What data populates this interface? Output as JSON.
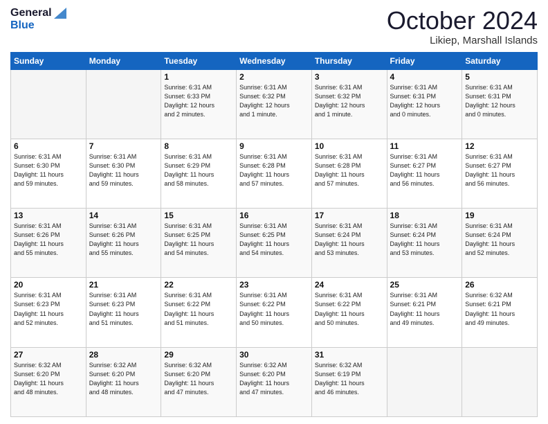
{
  "logo": {
    "line1": "General",
    "line2": "Blue"
  },
  "title": "October 2024",
  "location": "Likiep, Marshall Islands",
  "days_of_week": [
    "Sunday",
    "Monday",
    "Tuesday",
    "Wednesday",
    "Thursday",
    "Friday",
    "Saturday"
  ],
  "weeks": [
    [
      {
        "day": "",
        "detail": ""
      },
      {
        "day": "",
        "detail": ""
      },
      {
        "day": "1",
        "detail": "Sunrise: 6:31 AM\nSunset: 6:33 PM\nDaylight: 12 hours\nand 2 minutes."
      },
      {
        "day": "2",
        "detail": "Sunrise: 6:31 AM\nSunset: 6:32 PM\nDaylight: 12 hours\nand 1 minute."
      },
      {
        "day": "3",
        "detail": "Sunrise: 6:31 AM\nSunset: 6:32 PM\nDaylight: 12 hours\nand 1 minute."
      },
      {
        "day": "4",
        "detail": "Sunrise: 6:31 AM\nSunset: 6:31 PM\nDaylight: 12 hours\nand 0 minutes."
      },
      {
        "day": "5",
        "detail": "Sunrise: 6:31 AM\nSunset: 6:31 PM\nDaylight: 12 hours\nand 0 minutes."
      }
    ],
    [
      {
        "day": "6",
        "detail": "Sunrise: 6:31 AM\nSunset: 6:30 PM\nDaylight: 11 hours\nand 59 minutes."
      },
      {
        "day": "7",
        "detail": "Sunrise: 6:31 AM\nSunset: 6:30 PM\nDaylight: 11 hours\nand 59 minutes."
      },
      {
        "day": "8",
        "detail": "Sunrise: 6:31 AM\nSunset: 6:29 PM\nDaylight: 11 hours\nand 58 minutes."
      },
      {
        "day": "9",
        "detail": "Sunrise: 6:31 AM\nSunset: 6:28 PM\nDaylight: 11 hours\nand 57 minutes."
      },
      {
        "day": "10",
        "detail": "Sunrise: 6:31 AM\nSunset: 6:28 PM\nDaylight: 11 hours\nand 57 minutes."
      },
      {
        "day": "11",
        "detail": "Sunrise: 6:31 AM\nSunset: 6:27 PM\nDaylight: 11 hours\nand 56 minutes."
      },
      {
        "day": "12",
        "detail": "Sunrise: 6:31 AM\nSunset: 6:27 PM\nDaylight: 11 hours\nand 56 minutes."
      }
    ],
    [
      {
        "day": "13",
        "detail": "Sunrise: 6:31 AM\nSunset: 6:26 PM\nDaylight: 11 hours\nand 55 minutes."
      },
      {
        "day": "14",
        "detail": "Sunrise: 6:31 AM\nSunset: 6:26 PM\nDaylight: 11 hours\nand 55 minutes."
      },
      {
        "day": "15",
        "detail": "Sunrise: 6:31 AM\nSunset: 6:25 PM\nDaylight: 11 hours\nand 54 minutes."
      },
      {
        "day": "16",
        "detail": "Sunrise: 6:31 AM\nSunset: 6:25 PM\nDaylight: 11 hours\nand 54 minutes."
      },
      {
        "day": "17",
        "detail": "Sunrise: 6:31 AM\nSunset: 6:24 PM\nDaylight: 11 hours\nand 53 minutes."
      },
      {
        "day": "18",
        "detail": "Sunrise: 6:31 AM\nSunset: 6:24 PM\nDaylight: 11 hours\nand 53 minutes."
      },
      {
        "day": "19",
        "detail": "Sunrise: 6:31 AM\nSunset: 6:24 PM\nDaylight: 11 hours\nand 52 minutes."
      }
    ],
    [
      {
        "day": "20",
        "detail": "Sunrise: 6:31 AM\nSunset: 6:23 PM\nDaylight: 11 hours\nand 52 minutes."
      },
      {
        "day": "21",
        "detail": "Sunrise: 6:31 AM\nSunset: 6:23 PM\nDaylight: 11 hours\nand 51 minutes."
      },
      {
        "day": "22",
        "detail": "Sunrise: 6:31 AM\nSunset: 6:22 PM\nDaylight: 11 hours\nand 51 minutes."
      },
      {
        "day": "23",
        "detail": "Sunrise: 6:31 AM\nSunset: 6:22 PM\nDaylight: 11 hours\nand 50 minutes."
      },
      {
        "day": "24",
        "detail": "Sunrise: 6:31 AM\nSunset: 6:22 PM\nDaylight: 11 hours\nand 50 minutes."
      },
      {
        "day": "25",
        "detail": "Sunrise: 6:31 AM\nSunset: 6:21 PM\nDaylight: 11 hours\nand 49 minutes."
      },
      {
        "day": "26",
        "detail": "Sunrise: 6:32 AM\nSunset: 6:21 PM\nDaylight: 11 hours\nand 49 minutes."
      }
    ],
    [
      {
        "day": "27",
        "detail": "Sunrise: 6:32 AM\nSunset: 6:20 PM\nDaylight: 11 hours\nand 48 minutes."
      },
      {
        "day": "28",
        "detail": "Sunrise: 6:32 AM\nSunset: 6:20 PM\nDaylight: 11 hours\nand 48 minutes."
      },
      {
        "day": "29",
        "detail": "Sunrise: 6:32 AM\nSunset: 6:20 PM\nDaylight: 11 hours\nand 47 minutes."
      },
      {
        "day": "30",
        "detail": "Sunrise: 6:32 AM\nSunset: 6:20 PM\nDaylight: 11 hours\nand 47 minutes."
      },
      {
        "day": "31",
        "detail": "Sunrise: 6:32 AM\nSunset: 6:19 PM\nDaylight: 11 hours\nand 46 minutes."
      },
      {
        "day": "",
        "detail": ""
      },
      {
        "day": "",
        "detail": ""
      }
    ]
  ]
}
